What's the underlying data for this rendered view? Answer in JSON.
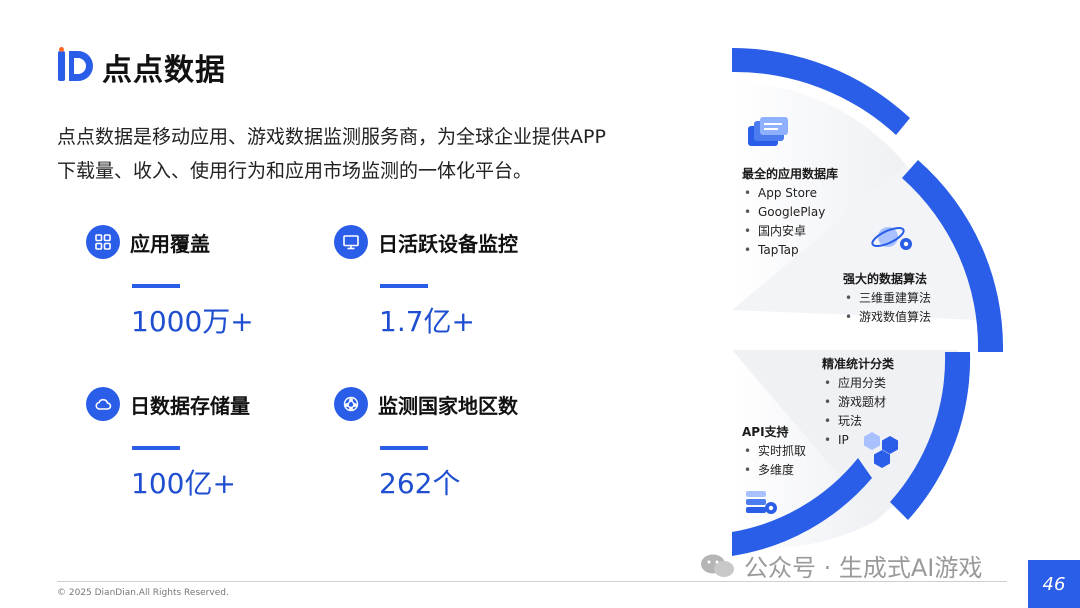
{
  "brand": {
    "name": "点点数据"
  },
  "intro": {
    "line1": "点点数据是移动应用、游戏数据监测服务商，为全球企业提供APP",
    "line2": "下载量、收入、使用行为和应用市场监测的一体化平台。"
  },
  "metrics": [
    {
      "label": "应用覆盖",
      "value": "1000万+",
      "icon": "grid-icon"
    },
    {
      "label": "日活跃设备监控",
      "value": "1.7亿+",
      "icon": "monitor-icon"
    },
    {
      "label": "日数据存储量",
      "value": "100亿+",
      "icon": "cloud-icon"
    },
    {
      "label": "监测国家地区数",
      "value": "262个",
      "icon": "globe-network-icon"
    }
  ],
  "segments": [
    {
      "title": "最全的应用数据库",
      "items": [
        "App Store",
        "GooglePlay",
        "国内安卓",
        "TapTap"
      ],
      "icon": "database-cards-icon"
    },
    {
      "title": "强大的数据算法",
      "items": [
        "三维重建算法",
        "游戏数值算法"
      ],
      "icon": "orbit-gear-icon"
    },
    {
      "title": "精准统计分类",
      "items": [
        "应用分类",
        "游戏题材",
        "玩法",
        "IP"
      ],
      "icon": "hexagon-cluster-icon"
    },
    {
      "title": "API支持",
      "items": [
        "实时抓取",
        "多维度"
      ],
      "icon": "server-gear-icon"
    }
  ],
  "footer": {
    "copyright": "© 2025 DianDian.All Rights Reserved."
  },
  "page": {
    "number": "46"
  },
  "watermark": {
    "text": "公众号 · 生成式AI游戏"
  },
  "colors": {
    "accent": "#2a5ee8",
    "value": "#1f4fd0"
  }
}
